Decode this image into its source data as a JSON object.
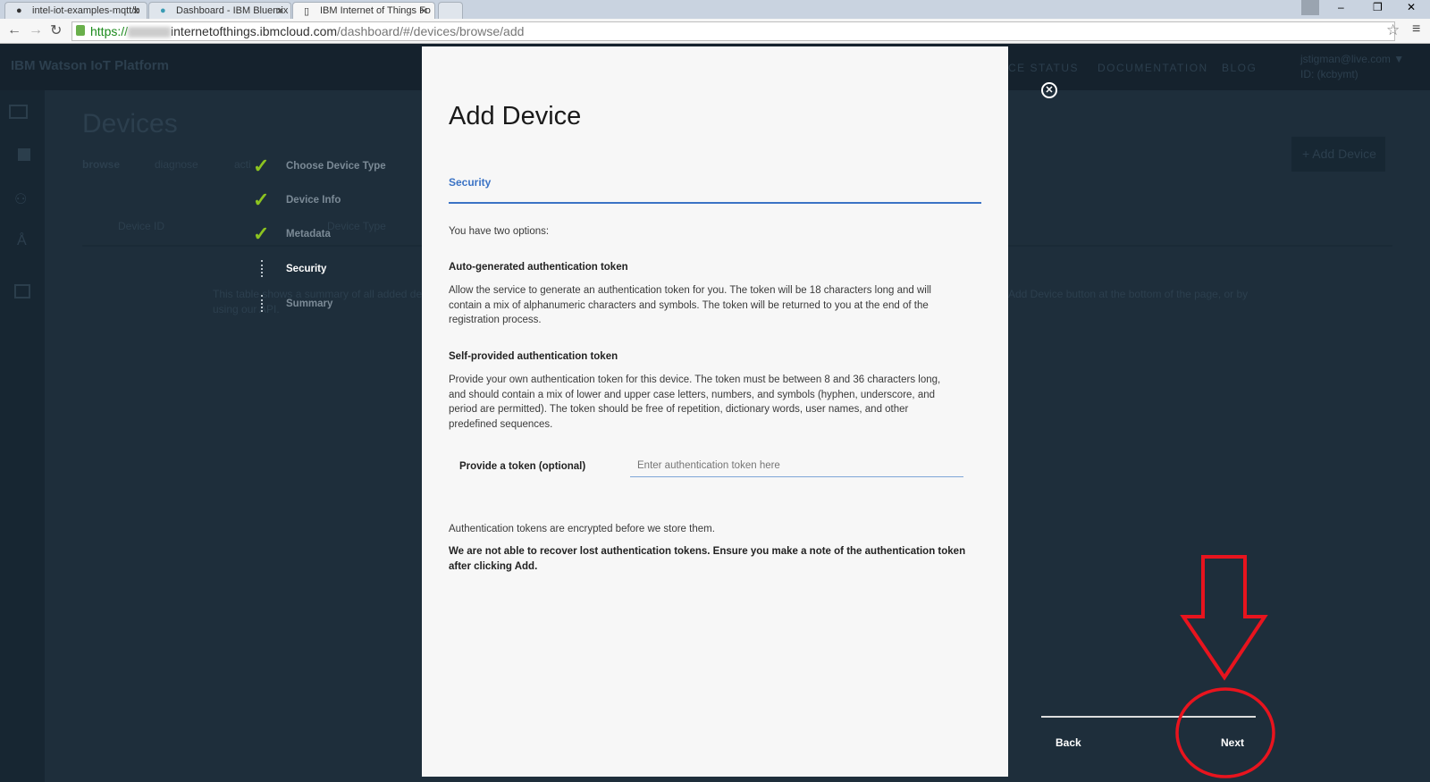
{
  "browser": {
    "tabs": [
      {
        "label": "intel-iot-examples-mqtt/b"
      },
      {
        "label": "Dashboard - IBM Bluemix"
      },
      {
        "label": "IBM Internet of Things Fo"
      }
    ],
    "url_scheme": "https://",
    "url_host": "internetofthings.ibmcloud.com",
    "url_path": "/dashboard/#/devices/browse/add"
  },
  "background": {
    "app_title": "IBM Watson IoT Platform",
    "nav": [
      "CE STATUS",
      "DOCUMENTATION",
      "BLOG"
    ],
    "user": "jstigman@live.com ▼",
    "org_id": "ID: (kcbymt)",
    "page_title": "Devices",
    "subnav": [
      "browse",
      "diagnose",
      "acti"
    ],
    "add_button": "+ Add Device",
    "columns": [
      "Device ID",
      "Device Type"
    ],
    "info": "This table shows a summary of all added de",
    "info2": "using our API.",
    "info_right": "Add Device button at the bottom of the page, or by"
  },
  "wizard": {
    "steps": [
      {
        "label": "Choose Device Type",
        "state": "done"
      },
      {
        "label": "Device Info",
        "state": "done"
      },
      {
        "label": "Metadata",
        "state": "done"
      },
      {
        "label": "Security",
        "state": "current"
      },
      {
        "label": "Summary",
        "state": "pending"
      }
    ],
    "back": "Back",
    "next": "Next"
  },
  "modal": {
    "title": "Add Device",
    "tab": "Security",
    "intro": "You have two options:",
    "auto_heading": "Auto-generated authentication token",
    "auto_text": "Allow the service to generate an authentication token for you. The token will be 18 characters long and will contain a mix of alphanumeric characters and symbols. The token will be returned to you at the end of the registration process.",
    "self_heading": "Self-provided authentication token",
    "self_text": "Provide your own authentication token for this device. The token must be between 8 and 36 characters long, and should contain a mix of lower and upper case letters, numbers, and symbols (hyphen, underscore, and period are permitted). The token should be free of repetition, dictionary words, user names, and other predefined sequences.",
    "token_label": "Provide a token (optional)",
    "token_placeholder": "Enter authentication token here",
    "token_value": "",
    "note": "Authentication tokens are encrypted before we store them.",
    "warning": "We are not able to recover lost authentication tokens. Ensure you make a note of the authentication token after clicking Add."
  },
  "colors": {
    "accent": "#3b73c5",
    "check": "#8cc320",
    "annotation": "#e8141e"
  }
}
